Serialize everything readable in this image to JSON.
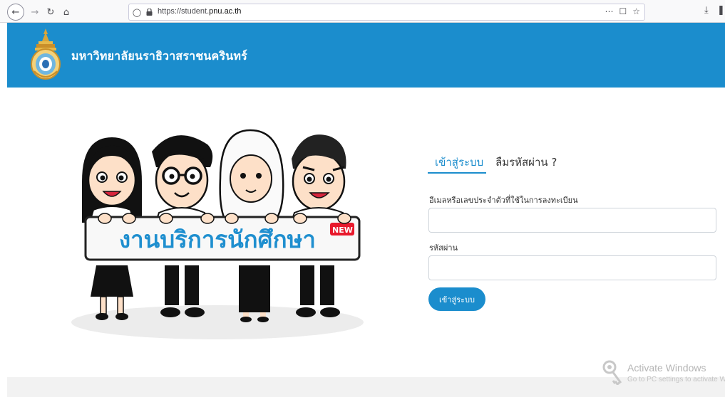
{
  "browser": {
    "url_prefix": "https://student.",
    "url_domain": "pnu.ac.th"
  },
  "header": {
    "university_name": "มหาวิทยาลัยนราธิวาสราชนครินทร์"
  },
  "illustration": {
    "banner_text": "งานบริการนักศึกษา",
    "badge_text": "NEW"
  },
  "login": {
    "tab_login": "เข้าสู่ระบบ",
    "tab_forgot": "ลืมรหัสผ่าน ?",
    "email_label": "อีเมลหรือเลขประจำตัวที่ใช้ในการลงทะเบียน",
    "email_value": "",
    "password_label": "รหัสผ่าน",
    "password_value": "",
    "submit_label": "เข้าสู่ระบบ"
  },
  "watermark": {
    "title": "Activate Windows",
    "subtitle": "Go to PC settings to activate Windows."
  },
  "colors": {
    "brand_blue": "#1b8dcd",
    "badge_red": "#e8192c"
  }
}
